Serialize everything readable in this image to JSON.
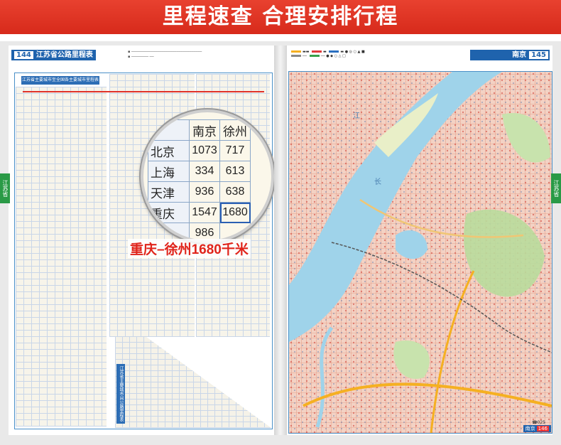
{
  "banner": {
    "title": "里程速查  合理安排行程"
  },
  "left_page": {
    "page_number": "144",
    "header": "江苏省公路里程表",
    "side_tab": "江苏省",
    "table_title": "江苏省主要城市至全国各主要城市里程表",
    "triangle_title": "江苏省主要城市间公路里程表",
    "magnifier": {
      "columns": [
        "南京",
        "徐州"
      ],
      "rows": [
        {
          "city": "北京",
          "values": [
            "1073",
            "717"
          ]
        },
        {
          "city": "上海",
          "values": [
            "334",
            "613"
          ]
        },
        {
          "city": "天津",
          "values": [
            "936",
            "638"
          ]
        },
        {
          "city": "重庆",
          "values": [
            "1547",
            "1680"
          ]
        },
        {
          "city": "",
          "values": [
            "986",
            ""
          ]
        }
      ],
      "highlight": {
        "row": 3,
        "col": 1
      }
    },
    "caption": "重庆–徐州1680千米"
  },
  "right_page": {
    "page_number": "145",
    "header": "南京",
    "side_tab": "江苏省",
    "footer_city": "南京",
    "footer_page": "146",
    "phone_code": "☎025",
    "river_labels": [
      "长",
      "江"
    ],
    "colors": {
      "water": "#9fd3ea",
      "urban": "#f3bda7",
      "green": "#b9dc9c",
      "road_major": "#f5b021"
    }
  },
  "colors": {
    "banner": "#d72a1b",
    "header_blue": "#1f63ad",
    "tab_green": "#2a9a46",
    "caption_red": "#e0241b"
  }
}
